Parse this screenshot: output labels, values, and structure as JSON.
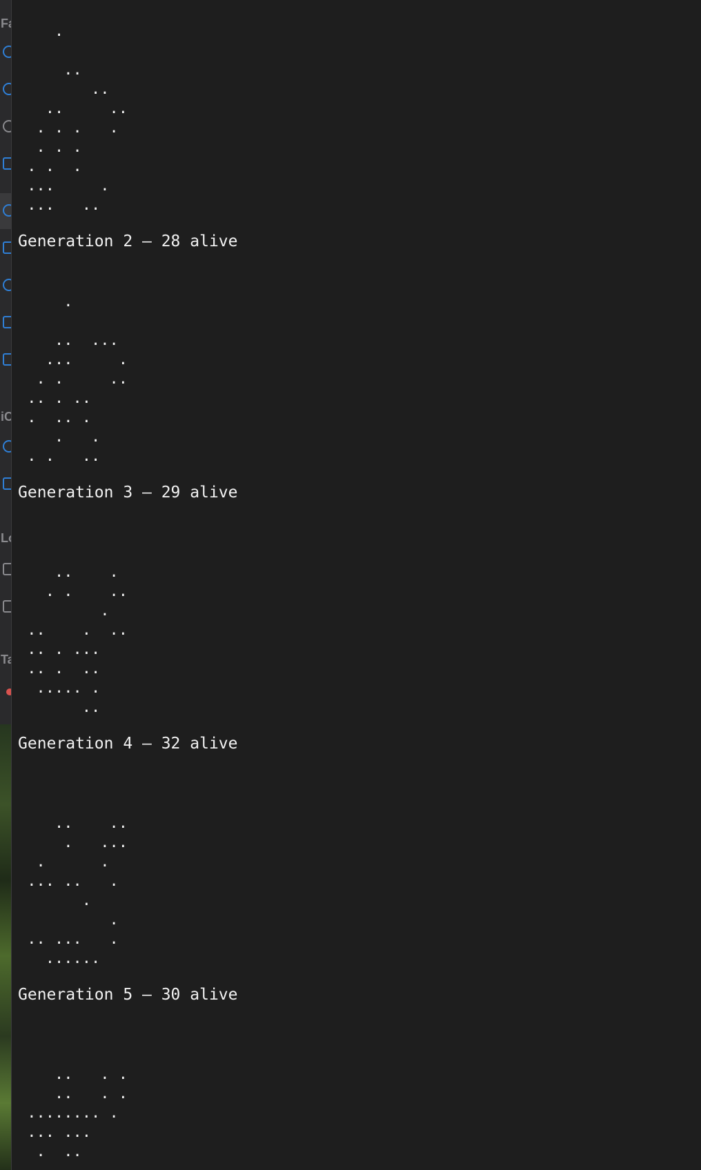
{
  "console": {
    "blocks": [
      {
        "rows": [
          "    .",
          "",
          "     ..",
          "        ..",
          "   ..     ..",
          "  . . .   .",
          "  . . .",
          " . .  .",
          " ...     .",
          " ...   .."
        ]
      },
      {
        "header": "Generation 2 — 28 alive",
        "rows": [
          "",
          "",
          "     .",
          "",
          "    ..  ...",
          "   ...     .",
          "  . .     ..",
          " .. . ..",
          " .  .. .",
          "    .   .",
          " . .   .."
        ]
      },
      {
        "header": "Generation 3 — 29 alive",
        "rows": [
          "",
          "",
          "",
          "    ..    .",
          "   . .    ..",
          "         .",
          " ..    .  ..",
          " .. . ...",
          " .. .  ..",
          "  ..... .",
          "       .."
        ]
      },
      {
        "header": "Generation 4 — 32 alive",
        "rows": [
          "",
          "",
          "",
          "    ..    ..",
          "     .   ...",
          "  .      .",
          " ... ..   .",
          "       .",
          "          .",
          " .. ...   .",
          "   ......"
        ]
      },
      {
        "header": "Generation 5 — 30 alive",
        "rows": [
          "",
          "",
          "",
          "    ..   . .",
          "    ..   . .",
          " ........ .",
          " ... ...",
          "  .  .."
        ]
      }
    ]
  },
  "sidebar": {
    "section_labels": [
      "Fa",
      "iC",
      "Lo",
      "Ta"
    ],
    "icons": [
      "target-icon",
      "clock-icon",
      "app-icon",
      "document-icon",
      "download-icon",
      "document-icon",
      "music-icon",
      "photo-icon",
      "home-icon",
      "cloud-icon",
      "folder-icon",
      "laptop-icon",
      "drive-icon",
      "tag-red-icon"
    ]
  }
}
